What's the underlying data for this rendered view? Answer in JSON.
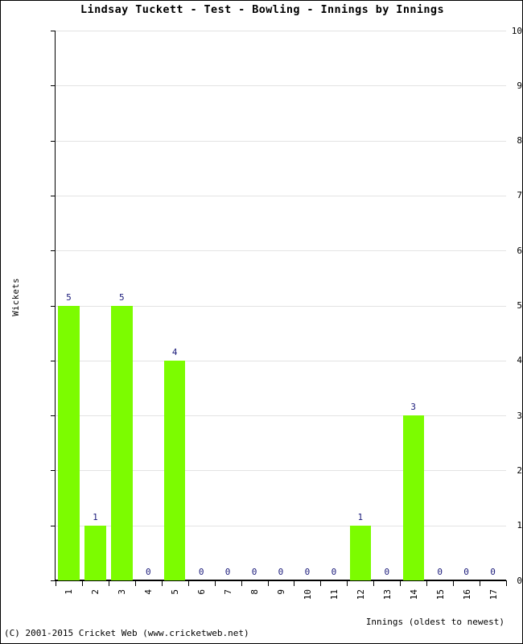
{
  "chart_data": {
    "type": "bar",
    "title": "Lindsay Tuckett - Test - Bowling - Innings by Innings",
    "xlabel": "Innings (oldest to newest)",
    "ylabel": "Wickets",
    "categories": [
      "1",
      "2",
      "3",
      "4",
      "5",
      "6",
      "7",
      "8",
      "9",
      "10",
      "11",
      "12",
      "13",
      "14",
      "15",
      "16",
      "17"
    ],
    "values": [
      5,
      1,
      5,
      0,
      4,
      0,
      0,
      0,
      0,
      0,
      0,
      1,
      0,
      3,
      0,
      0,
      0
    ],
    "value_labels": [
      "5",
      "1",
      "5",
      "0",
      "4",
      "0",
      "0",
      "0",
      "0",
      "0",
      "0",
      "1",
      "0",
      "3",
      "0",
      "0",
      "0"
    ],
    "ylim": [
      0,
      10
    ],
    "ytick_labels": [
      "0",
      "1",
      "2",
      "3",
      "4",
      "5",
      "6",
      "7",
      "8",
      "9",
      "10"
    ],
    "grid": true,
    "legend": "none",
    "bar_color": "#7CFC00",
    "value_label_color": "#1a1a7a",
    "gridline_color": "#e3e3e3",
    "axis_color": "#000000"
  },
  "footer": {
    "copyright": "(C) 2001-2015 Cricket Web (www.cricketweb.net)"
  }
}
